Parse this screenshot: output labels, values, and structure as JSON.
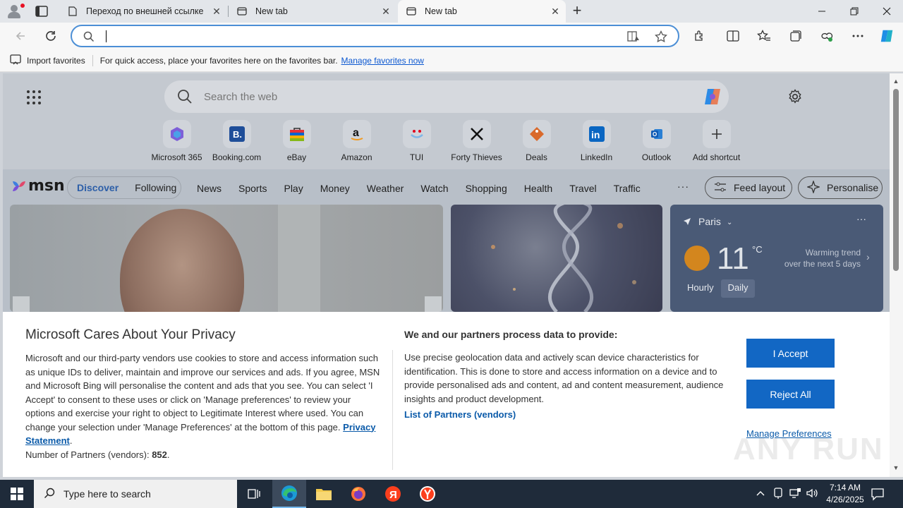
{
  "tabs": [
    {
      "title": "Переход по внешней ссылке",
      "icon": "page-icon"
    },
    {
      "title": "New tab",
      "icon": "newtab-icon"
    },
    {
      "title": "New tab",
      "icon": "newtab-icon",
      "active": true
    }
  ],
  "favorites_bar": {
    "import_label": "Import favorites",
    "message": "For quick access, place your favorites here on the favorites bar.",
    "manage_link": "Manage favorites now"
  },
  "ntp": {
    "search_placeholder": "Search the web",
    "shortcuts": [
      {
        "label": "Microsoft 365",
        "icon": "m365-icon"
      },
      {
        "label": "Booking.com",
        "icon": "booking-icon"
      },
      {
        "label": "eBay",
        "icon": "ebay-icon"
      },
      {
        "label": "Amazon",
        "icon": "amazon-icon"
      },
      {
        "label": "TUI",
        "icon": "tui-icon"
      },
      {
        "label": "Forty Thieves",
        "icon": "forty-thieves-icon"
      },
      {
        "label": "Deals",
        "icon": "deals-icon"
      },
      {
        "label": "LinkedIn",
        "icon": "linkedin-icon"
      },
      {
        "label": "Outlook",
        "icon": "outlook-icon"
      },
      {
        "label": "Add shortcut",
        "icon": "plus-icon"
      }
    ]
  },
  "msn": {
    "logo": "msn",
    "discover": "Discover",
    "following": "Following",
    "nav": [
      "News",
      "Sports",
      "Play",
      "Money",
      "Weather",
      "Watch",
      "Shopping",
      "Health",
      "Travel",
      "Traffic"
    ],
    "more": "···",
    "feed_layout": "Feed layout",
    "personalise": "Personalise"
  },
  "weather": {
    "city": "Paris",
    "temp": "11",
    "unit": "°C",
    "trend_line1": "Warming trend",
    "trend_line2": "over the next 5 days",
    "hourly": "Hourly",
    "daily": "Daily",
    "menu": "···"
  },
  "privacy": {
    "title": "Microsoft Cares About Your Privacy",
    "body": "Microsoft and our third-party vendors use cookies to store and access information such as unique IDs to deliver, maintain and improve our services and ads. If you agree, MSN and Microsoft Bing will personalise the content and ads that you see. You can select 'I Accept' to consent to these uses or click on 'Manage preferences' to review your options and exercise your right to object to Legitimate Interest where used.  You can change your selection under 'Manage Preferences' at the bottom of this page.",
    "privacy_link": "Privacy Statement",
    "partners_label": "Number of Partners (vendors):",
    "partners_count": "852",
    "heading2": "We and our partners process data to provide:",
    "body2": "Use precise geolocation data and actively scan device characteristics for identification. This is done to store and access information on a device and to provide personalised ads and content, ad and content measurement, audience insights and product development.",
    "list_link": "List of Partners (vendors)",
    "accept": "I Accept",
    "reject": "Reject All",
    "manage": "Manage Preferences"
  },
  "watermark": "ANY RUN",
  "taskbar": {
    "search_placeholder": "Type here to search",
    "time": "7:14 AM",
    "date": "4/26/2025"
  },
  "colors": {
    "accent": "#1267c4",
    "link": "#0b57d0",
    "taskbar": "#1f2b3a"
  }
}
